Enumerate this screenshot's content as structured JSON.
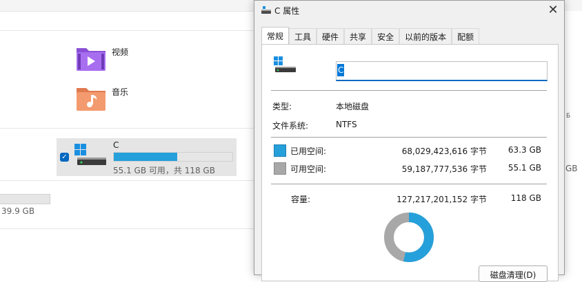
{
  "explorer": {
    "folders": [
      {
        "label": "视频",
        "icon": "videos-folder-icon"
      },
      {
        "label": "音乐",
        "icon": "music-folder-icon"
      }
    ],
    "drive": {
      "name": "C",
      "free_text": "55.1 GB 可用，共 118 GB",
      "used_fraction": 0.535,
      "checked": true
    },
    "other_drive": {
      "size_text": "39.9 GB"
    },
    "right_peek_top": "Б",
    "right_peek_size": "GB"
  },
  "dialog": {
    "title": "C 属性",
    "close_glyph": "✕",
    "tabs": [
      "常规",
      "工具",
      "硬件",
      "共享",
      "安全",
      "以前的版本",
      "配额"
    ],
    "active_tab": 0,
    "name_value": "C",
    "type_label": "类型:",
    "type_value": "本地磁盘",
    "fs_label": "文件系统:",
    "fs_value": "NTFS",
    "used_label": "已用空间:",
    "used_bytes": "68,029,423,616 字节",
    "used_gb": "63.3 GB",
    "free_label": "可用空间:",
    "free_bytes": "59,187,777,536 字节",
    "free_gb": "55.1 GB",
    "capacity_label": "容量:",
    "capacity_bytes": "127,217,201,152 字节",
    "capacity_gb": "118 GB",
    "cleanup_label": "磁盘清理(D)"
  },
  "colors": {
    "used": "#26a0da",
    "free": "#a8a8a8",
    "accent": "#0067c0"
  }
}
